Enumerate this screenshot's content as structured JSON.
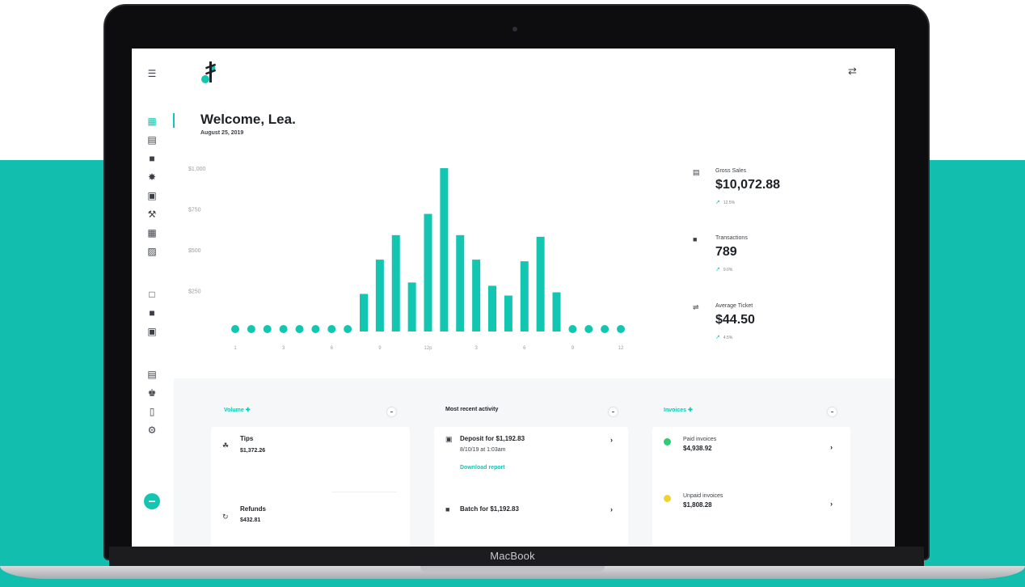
{
  "device": {
    "label": "MacBook"
  },
  "colors": {
    "brand": "#13c6b1",
    "background_band": "#12bfae",
    "text_dark": "#1d2126",
    "paid": "#2ecc71",
    "unpaid": "#f2d22e"
  },
  "sidebar": {
    "menu_icon": "hamburger-menu-icon",
    "items": [
      {
        "icon": "dashboard-icon",
        "active": true
      },
      {
        "icon": "reports-icon"
      },
      {
        "icon": "transactions-icon"
      },
      {
        "icon": "settings-cog-icon"
      },
      {
        "icon": "deposits-icon"
      },
      {
        "icon": "tools-icon"
      },
      {
        "icon": "grid-icon"
      },
      {
        "icon": "document-icon"
      },
      {
        "icon": "terminal-icon"
      },
      {
        "icon": "batch-icon"
      },
      {
        "icon": "invoice-icon"
      },
      {
        "icon": "store-icon"
      },
      {
        "icon": "team-icon"
      },
      {
        "icon": "device-icon"
      },
      {
        "icon": "gear-icon"
      }
    ],
    "fab_icon": "quick-action-icon"
  },
  "header": {
    "logo": "brand-logo",
    "swap_icon": "swap-icon"
  },
  "welcome": {
    "title": "Welcome, Lea.",
    "date": "August 25, 2019"
  },
  "chart_data": {
    "type": "bar",
    "title": "",
    "xlabel": "",
    "ylabel": "",
    "y_ticks": [
      "$1,000",
      "$750",
      "$500",
      "$250"
    ],
    "x_tick_labels": [
      "1",
      "3",
      "6",
      "9",
      "12p",
      "3",
      "6",
      "9",
      "12"
    ],
    "ylim": [
      0,
      1000
    ],
    "values": [
      0,
      0,
      0,
      0,
      0,
      0,
      0,
      0,
      230,
      440,
      590,
      300,
      720,
      1000,
      590,
      440,
      280,
      220,
      430,
      580,
      240,
      0,
      0,
      0,
      0
    ],
    "grid": false,
    "color": "#13c6b1"
  },
  "stats": [
    {
      "icon": "bar-chart-icon",
      "label": "Gross Sales",
      "value": "$10,072.88",
      "change": "12.5%"
    },
    {
      "icon": "transactions-icon",
      "label": "Transactions",
      "value": "789",
      "change": "9.0%"
    },
    {
      "icon": "ticket-icon",
      "label": "Average Ticket",
      "value": "$44.50",
      "change": "4.5%"
    }
  ],
  "volume_card": {
    "header": "Volume",
    "rows": [
      {
        "icon": "tips-icon",
        "title": "Tips",
        "value": "$1,372.26"
      },
      {
        "icon": "refund-icon",
        "title": "Refunds",
        "value": "$432.81"
      }
    ]
  },
  "activity_card": {
    "header": "Most recent activity",
    "rows": [
      {
        "icon": "deposit-icon",
        "title": "Deposit for $1,192.83",
        "sub": "8/10/19 at 1:03am",
        "link": "Download report"
      },
      {
        "icon": "batch-icon",
        "title": "Batch for $1,192.83"
      }
    ]
  },
  "invoices_card": {
    "header": "Invoices",
    "rows": [
      {
        "icon": "check-circle-icon",
        "title": "Paid invoices",
        "value": "$4,938.92"
      },
      {
        "icon": "warning-circle-icon",
        "title": "Unpaid invoices",
        "value": "$1,808.28"
      }
    ]
  }
}
